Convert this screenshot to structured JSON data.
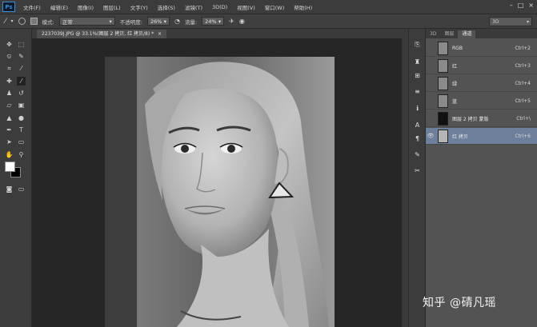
{
  "app": {
    "logo": "Ps"
  },
  "menu": [
    "文件(F)",
    "编辑(E)",
    "图像(I)",
    "图层(L)",
    "文字(Y)",
    "选择(S)",
    "滤镜(T)",
    "3D(D)",
    "视图(V)",
    "窗口(W)",
    "帮助(H)"
  ],
  "window_controls": {
    "minimize": "–",
    "restore": "□",
    "close": "×"
  },
  "options": {
    "mode_label": "模式:",
    "mode_value": "正常",
    "opacity_label": "不透明度:",
    "opacity_value": "26%",
    "flow_label": "流量:",
    "flow_value": "24%",
    "workspace": "3D"
  },
  "document": {
    "tab_title": "2237039J.JPG @ 33.1%(图层 2 拷贝, 红 拷贝/8) *",
    "close": "×"
  },
  "panel": {
    "tabs": [
      "3D",
      "图层",
      "通道"
    ],
    "channels": [
      {
        "name": "RGB",
        "shortcut": "Ctrl+2",
        "visible": false,
        "selected": false
      },
      {
        "name": "红",
        "shortcut": "Ctrl+3",
        "visible": false,
        "selected": false
      },
      {
        "name": "绿",
        "shortcut": "Ctrl+4",
        "visible": false,
        "selected": false
      },
      {
        "name": "蓝",
        "shortcut": "Ctrl+5",
        "visible": false,
        "selected": false
      },
      {
        "name": "图层 2 拷贝 蒙版",
        "shortcut": "Ctrl+\\",
        "visible": false,
        "selected": false
      },
      {
        "name": "红 拷贝",
        "shortcut": "Ctrl+6",
        "visible": true,
        "selected": true
      }
    ]
  },
  "watermark": "知乎 @碃凡瑶"
}
